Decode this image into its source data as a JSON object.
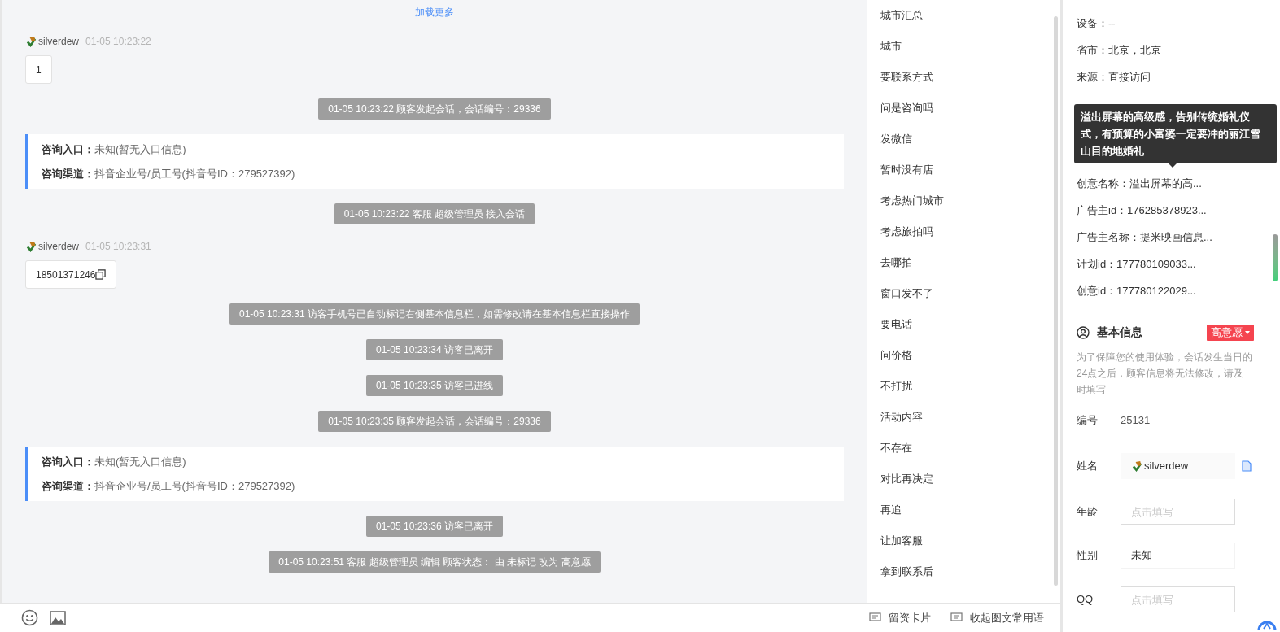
{
  "chat": {
    "load_more": "加载更多",
    "messages": [
      {
        "kind": "user",
        "name": "silverdew",
        "time": "01-05 10:23:22",
        "text": "1",
        "copyable": false
      },
      {
        "kind": "system",
        "text": "01-05 10:23:22 顾客发起会话，会话编号：29336"
      },
      {
        "kind": "entry",
        "rows": [
          {
            "label": "咨询入口：",
            "value": "未知(暂无入口信息)"
          },
          {
            "label": "咨询渠道：",
            "value": "抖音企业号/员工号(抖音号ID：279527392)"
          }
        ]
      },
      {
        "kind": "system",
        "text": "01-05 10:23:22 客服 超级管理员 接入会话"
      },
      {
        "kind": "user",
        "name": "silverdew",
        "time": "01-05 10:23:31",
        "text": "18501371246",
        "copyable": true
      },
      {
        "kind": "system",
        "text": "01-05 10:23:31 访客手机号已自动标记右侧基本信息栏，如需修改请在基本信息栏直接操作"
      },
      {
        "kind": "system",
        "text": "01-05 10:23:34 访客已离开"
      },
      {
        "kind": "system",
        "text": "01-05 10:23:35 访客已进线"
      },
      {
        "kind": "system",
        "text": "01-05 10:23:35 顾客发起会话，会话编号：29336"
      },
      {
        "kind": "entry",
        "rows": [
          {
            "label": "咨询入口：",
            "value": "未知(暂无入口信息)"
          },
          {
            "label": "咨询渠道：",
            "value": "抖音企业号/员工号(抖音号ID：279527392)"
          }
        ]
      },
      {
        "kind": "system",
        "text": "01-05 10:23:36 访客已离开"
      },
      {
        "kind": "system",
        "text": "01-05 10:23:51 客服 超级管理员 编辑 顾客状态： 由 未标记 改为 高意愿"
      }
    ]
  },
  "quick_phrases": [
    "城市汇总",
    "城市",
    "要联系方式",
    "问是咨询吗",
    "发微信",
    "暂时没有店",
    "考虑热门城市",
    "考虑旅拍吗",
    "去哪拍",
    "窗口发不了",
    "要电话",
    "问价格",
    "不打扰",
    "活动内容",
    "不存在",
    "对比再决定",
    "再追",
    "让加客服",
    "拿到联系后"
  ],
  "composer": {
    "actions": [
      {
        "label": "留资卡片"
      },
      {
        "label": "收起图文常用语"
      }
    ]
  },
  "visitor_info": {
    "rows_top": [
      "设备：--",
      "省市：北京，北京",
      "来源：直接访问"
    ],
    "tooltip": "溢出屏幕的高级感，告别传统婚礼仪式，有预算的小富婆一定要冲的丽江雪山目的地婚礼",
    "rows_bottom": [
      "创意名称：溢出屏幕的高...",
      "广告主id：176285378923...",
      "广告主名称：提米映画信息...",
      "计划id：177780109033...",
      "创意id：177780122029..."
    ]
  },
  "basic_info": {
    "title": "基本信息",
    "status": "高意愿",
    "note": "为了保障您的使用体验，会话发生当日的24点之后，顾客信息将无法修改，请及时填写",
    "fields": [
      {
        "kind": "text",
        "label": "编号",
        "value": "25131"
      },
      {
        "kind": "name",
        "label": "姓名",
        "value": "silverdew"
      },
      {
        "kind": "input",
        "label": "年龄",
        "placeholder": "点击填写"
      },
      {
        "kind": "select",
        "label": "性别",
        "value": "未知"
      },
      {
        "kind": "input",
        "label": "QQ",
        "placeholder": "点击填写"
      }
    ]
  }
}
